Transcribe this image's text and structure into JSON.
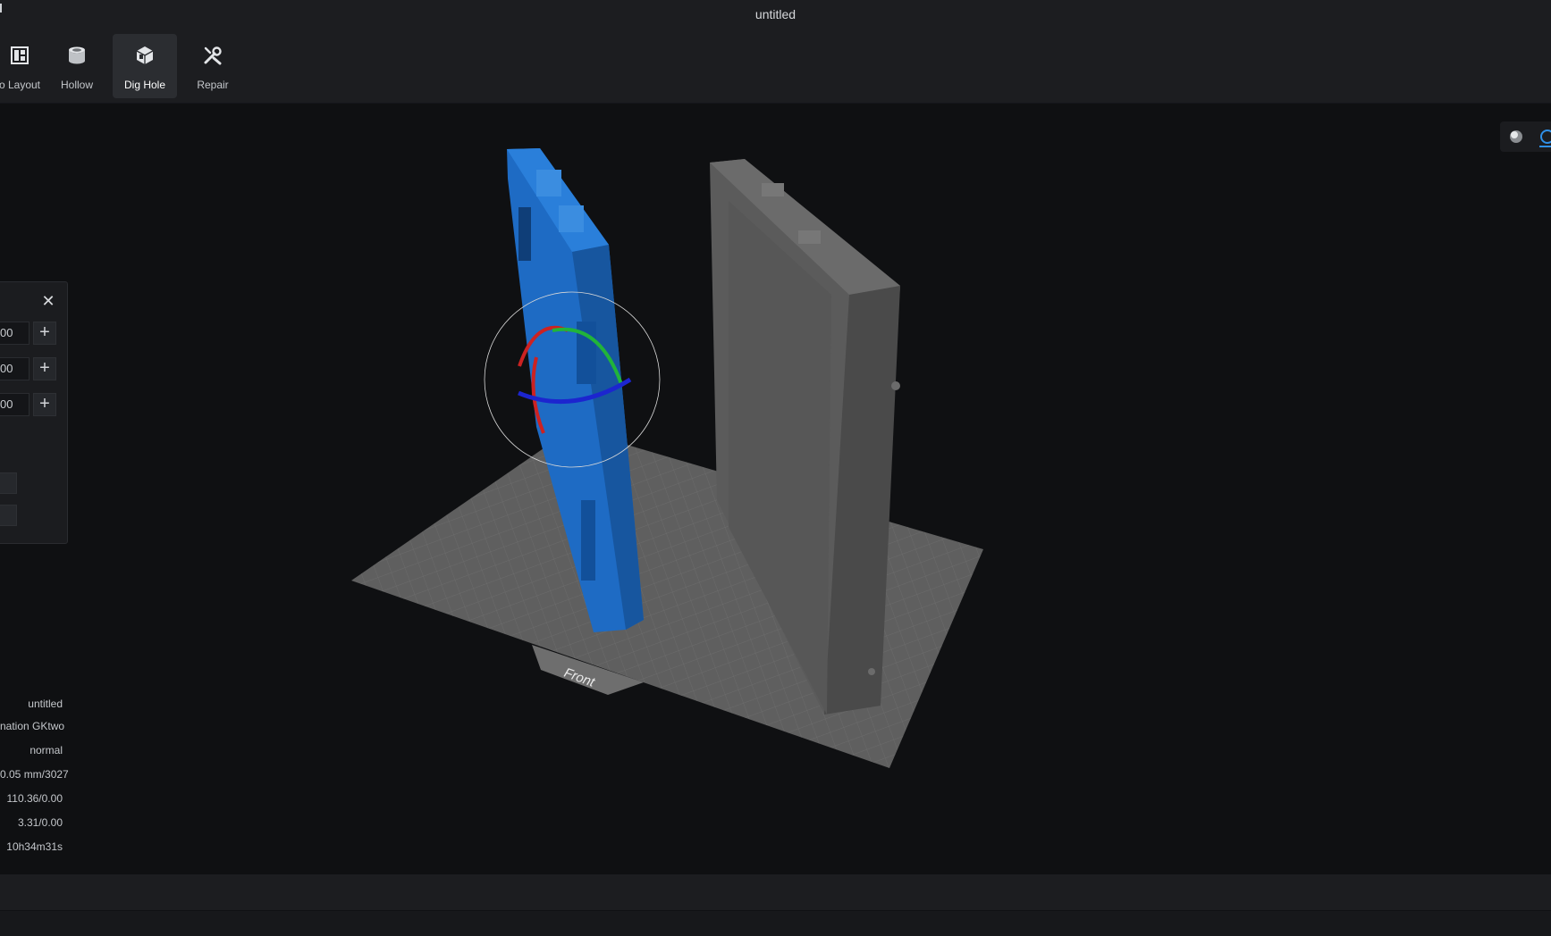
{
  "window": {
    "title": "untitled"
  },
  "toolbar": {
    "items": [
      {
        "label": "o Layout",
        "icon": "layout-icon"
      },
      {
        "label": "Hollow",
        "icon": "hollow-icon"
      },
      {
        "label": "Dig Hole",
        "icon": "dig-hole-icon",
        "active": true
      },
      {
        "label": "Repair",
        "icon": "repair-icon"
      }
    ]
  },
  "rotate_panel": {
    "close_icon": "close-icon",
    "fields": [
      {
        "value": "00"
      },
      {
        "value": "00"
      },
      {
        "value": "00"
      }
    ]
  },
  "viewport": {
    "plate_label": "Front",
    "colors": {
      "selected_model": "#1f6fc8",
      "model": "#5a5a5a",
      "plate": "#6a6a6a",
      "accent": "#2f8fe6"
    }
  },
  "print_info": {
    "lines": [
      "untitled",
      "nation GKtwo",
      "normal",
      "0.05 mm/3027",
      "110.36/0.00",
      "3.31/0.00",
      "10h34m31s"
    ]
  },
  "view_mode": {
    "icons": [
      "shaded-view-icon",
      "wireframe-view-icon"
    ]
  }
}
